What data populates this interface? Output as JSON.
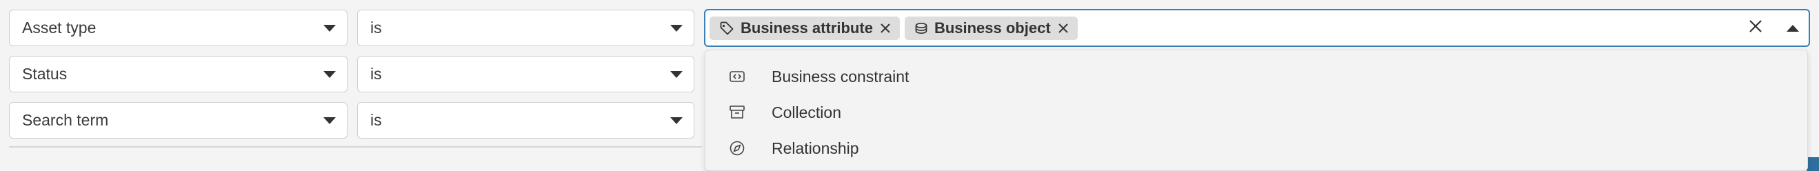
{
  "filters": [
    {
      "field": "Asset type",
      "operator": "is"
    },
    {
      "field": "Status",
      "operator": "is"
    },
    {
      "field": "Search term",
      "operator": "is"
    }
  ],
  "value_select": {
    "chips": [
      {
        "label": "Business attribute",
        "icon": "tag-icon"
      },
      {
        "label": "Business object",
        "icon": "database-icon"
      }
    ]
  },
  "dropdown": {
    "options": [
      {
        "label": "Business constraint",
        "icon": "code-box-icon"
      },
      {
        "label": "Collection",
        "icon": "archive-box-icon"
      },
      {
        "label": "Relationship",
        "icon": "compass-icon"
      }
    ]
  },
  "colors": {
    "focus_border": "#3a7fb6",
    "chip_bg": "#dddddd",
    "accent_edge": "#2f6f9f"
  }
}
